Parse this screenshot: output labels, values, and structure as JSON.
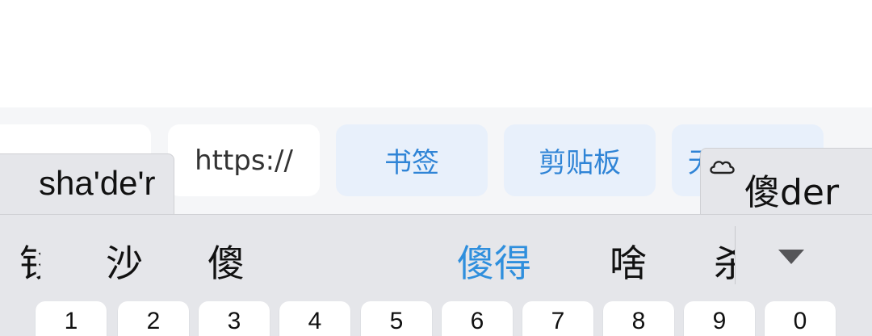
{
  "suggestion_chips": [
    {
      "label": "",
      "style": "plain"
    },
    {
      "label": "https://",
      "style": "plain"
    },
    {
      "label": "书签",
      "style": "blue"
    },
    {
      "label": "剪贴板",
      "style": "blue"
    },
    {
      "label": "无",
      "style": "blue"
    }
  ],
  "composing": {
    "text": "sha'de'r"
  },
  "cloud_prediction": {
    "icon": "cloud-icon",
    "text": "傻der"
  },
  "candidates": [
    "钐",
    "沙",
    "傻",
    "傻得",
    "啥",
    "杀"
  ],
  "highlighted_candidate_index": 3,
  "expand_button": {
    "icon": "triangle-down-icon"
  },
  "number_keys": [
    "1",
    "2",
    "3",
    "4",
    "5",
    "6",
    "7",
    "8",
    "9",
    "0"
  ],
  "colors": {
    "accent": "#2f8fdd",
    "keyboard_bg": "#e5e6ea",
    "chip_blue_bg": "#e8f0fb"
  }
}
